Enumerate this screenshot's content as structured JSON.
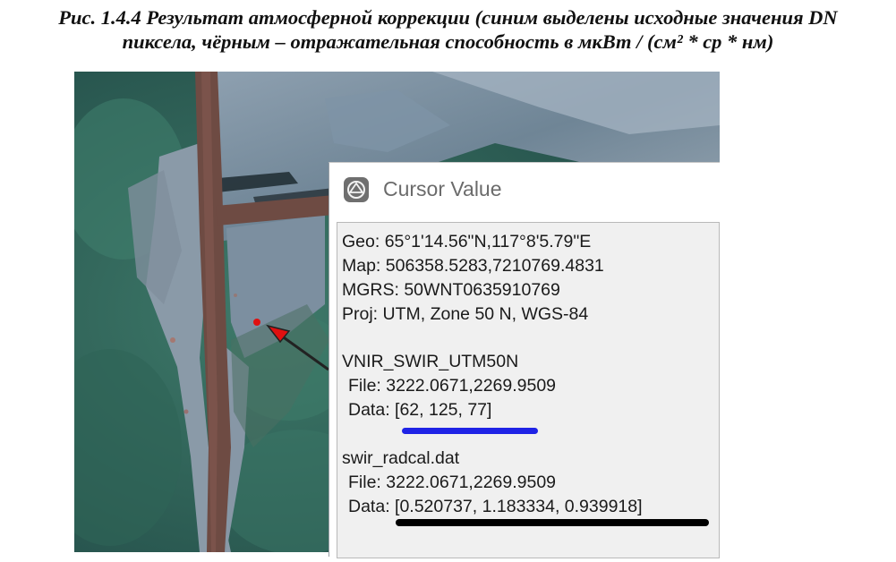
{
  "caption": {
    "line1": "Рис. 1.4.4 Результат атмосферной коррекции (синим выделены исходные значения DN",
    "line2": "пиксела, чёрным – отражательная способность в мкВт / (см² * ср * нм)"
  },
  "cursor_value": {
    "title": "Cursor Value",
    "geo": "Geo: 65°1'14.56\"N,117°8'5.79\"E",
    "map": "Map: 506358.5283,7210769.4831",
    "mgrs": "MGRS: 50WNT0635910769",
    "proj": "Proj: UTM, Zone 50 N, WGS-84",
    "layer1": {
      "name": "VNIR_SWIR_UTM50N",
      "file": "File: 3222.0671,2269.9509",
      "data": "Data: [62, 125, 77]"
    },
    "layer2": {
      "name": "swir_radcal.dat",
      "file": "File: 3222.0671,2269.9509",
      "data": "Data: [0.520737, 1.183334, 0.939918]"
    }
  },
  "colors": {
    "highlight_dn": "#1f23e6",
    "highlight_reflectance": "#000000",
    "pointer_dot": "#e01010"
  },
  "icons": [
    "cursor-value-app-icon",
    "pointer-arrow-icon"
  ]
}
